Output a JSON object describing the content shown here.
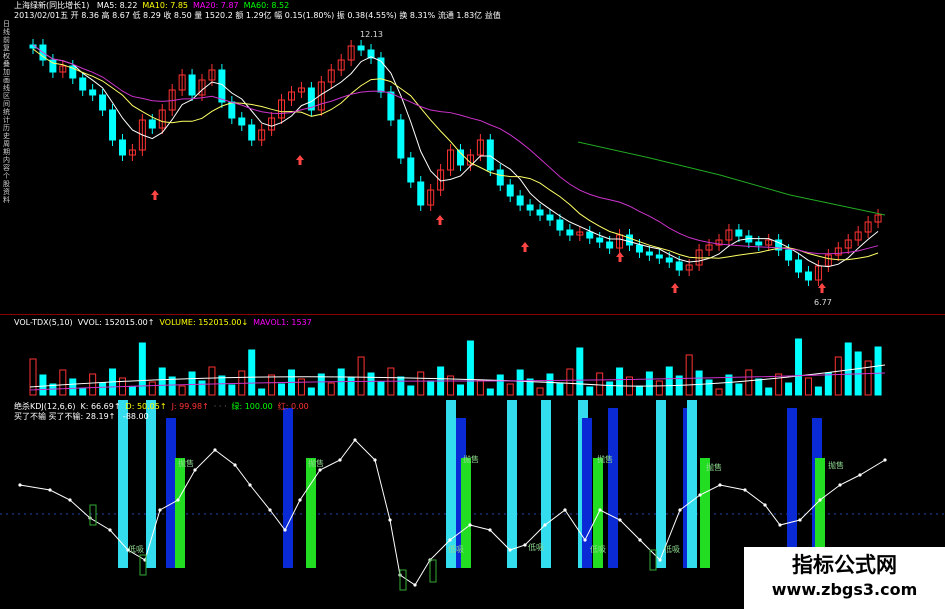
{
  "price_header": {
    "title": "上海绿新(同比增长1)",
    "date": "2013/02/01",
    "items": [
      {
        "label": "MA5:",
        "value": "8.22",
        "color": "#ffffff"
      },
      {
        "label": "MA10:",
        "value": "7.85",
        "color": "#ffff00"
      },
      {
        "label": "MA20:",
        "value": "7.87",
        "color": "#ff00ff"
      },
      {
        "label": "MA60:",
        "value": "8.52",
        "color": "#00ff00"
      }
    ],
    "row2": "2013/02/01五 开 8.36 高 8.67 低 8.29 收 8.50 量 1520.2 额 1.29亿 幅 0.15(1.80%) 振 0.38(4.55%) 换 8.31% 流通 1.83亿 益值",
    "high_label": "12.13",
    "low_label": "6.77"
  },
  "side_labels": "日线 前复权 叠加 画线 区间统计 历史 周期 内容 个股资料",
  "vol_header": {
    "items": [
      {
        "label": "VOL-TDX(5,10)",
        "value": "",
        "color": "#ffffff"
      },
      {
        "label": "VVOL:",
        "value": "152015.00↑",
        "color": "#ffffff"
      },
      {
        "label": "VOLUME:",
        "value": "152015.00↓",
        "color": "#ffff00"
      },
      {
        "label": "MAVOL1:",
        "value": "1537",
        "color": "#ff00ff"
      }
    ]
  },
  "kdj_header": {
    "row1": [
      {
        "label": "绝杀KDJ(12,6,6)",
        "value": "",
        "color": "#ffffff"
      },
      {
        "label": "K:",
        "value": "66.69↑",
        "color": "#ffffff"
      },
      {
        "label": "D:",
        "value": "50.05↑",
        "color": "#ffff00"
      },
      {
        "label": "J:",
        "value": "99.98↑",
        "color": "#ff3333"
      },
      {
        "label": "· · ·",
        "value": "",
        "color": "#888888"
      },
      {
        "label": "绿:",
        "value": "100.00",
        "color": "#00ff00"
      },
      {
        "label": "红:",
        "value": "0.00",
        "color": "#ff3333"
      }
    ],
    "row2": [
      {
        "label": "买了不输 买了不输:",
        "value": "28.19↑",
        "color": "#ffffff"
      },
      {
        "label": "",
        "value": "-88.00",
        "color": "#ffffff"
      }
    ]
  },
  "signal_labels": {
    "sell": "抛售",
    "buy": "低吸",
    "tag3": "介入"
  },
  "watermark": {
    "title": "指标公式网",
    "url": "www.zbgs3.com"
  },
  "colors": {
    "up": "#ff3333",
    "down": "#00ffff",
    "ma5": "#ffffff",
    "ma10": "#ffff66",
    "ma20": "#cc33cc",
    "ma60": "#22aa22"
  }
}
